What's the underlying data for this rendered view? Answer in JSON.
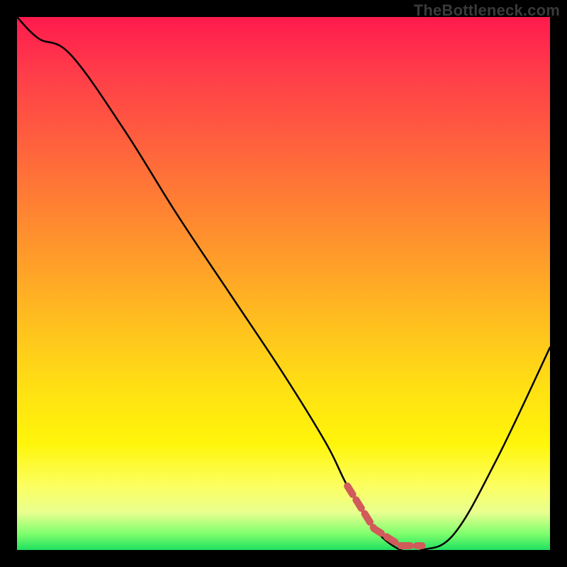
{
  "watermark": "TheBottleneck.com",
  "colors": {
    "frame": "#000000",
    "curve": "#000000",
    "bottom_accent": "#d15a5a",
    "gradient_stops": [
      "#ff1a4d",
      "#ff3b4a",
      "#ff5c3f",
      "#ff7d34",
      "#ff9e29",
      "#ffc11e",
      "#ffe113",
      "#fff50a",
      "#fcff60",
      "#e8ff90",
      "#7dff6d",
      "#20e060"
    ]
  },
  "chart_data": {
    "type": "line",
    "title": "",
    "xlabel": "",
    "ylabel": "",
    "xlim": [
      0,
      100
    ],
    "ylim": [
      0,
      100
    ],
    "x": [
      0,
      4,
      10,
      20,
      30,
      40,
      50,
      58,
      62,
      67,
      72,
      76,
      82,
      90,
      100
    ],
    "values": [
      100,
      96,
      93,
      79,
      63,
      48,
      33,
      20,
      12,
      4,
      0,
      0,
      3,
      17,
      38
    ],
    "annotations": [],
    "notes": "Bottleneck-style curve: a long descending limb to a flat minimum near x≈67–76, then a rising limb. y is qualitative (no axis ticks shown)."
  },
  "bottom_segment": {
    "x_start": 62,
    "x_end": 76,
    "description": "Thick reddish dashed/rounded segment hugging the curve minimum near the bottom."
  }
}
